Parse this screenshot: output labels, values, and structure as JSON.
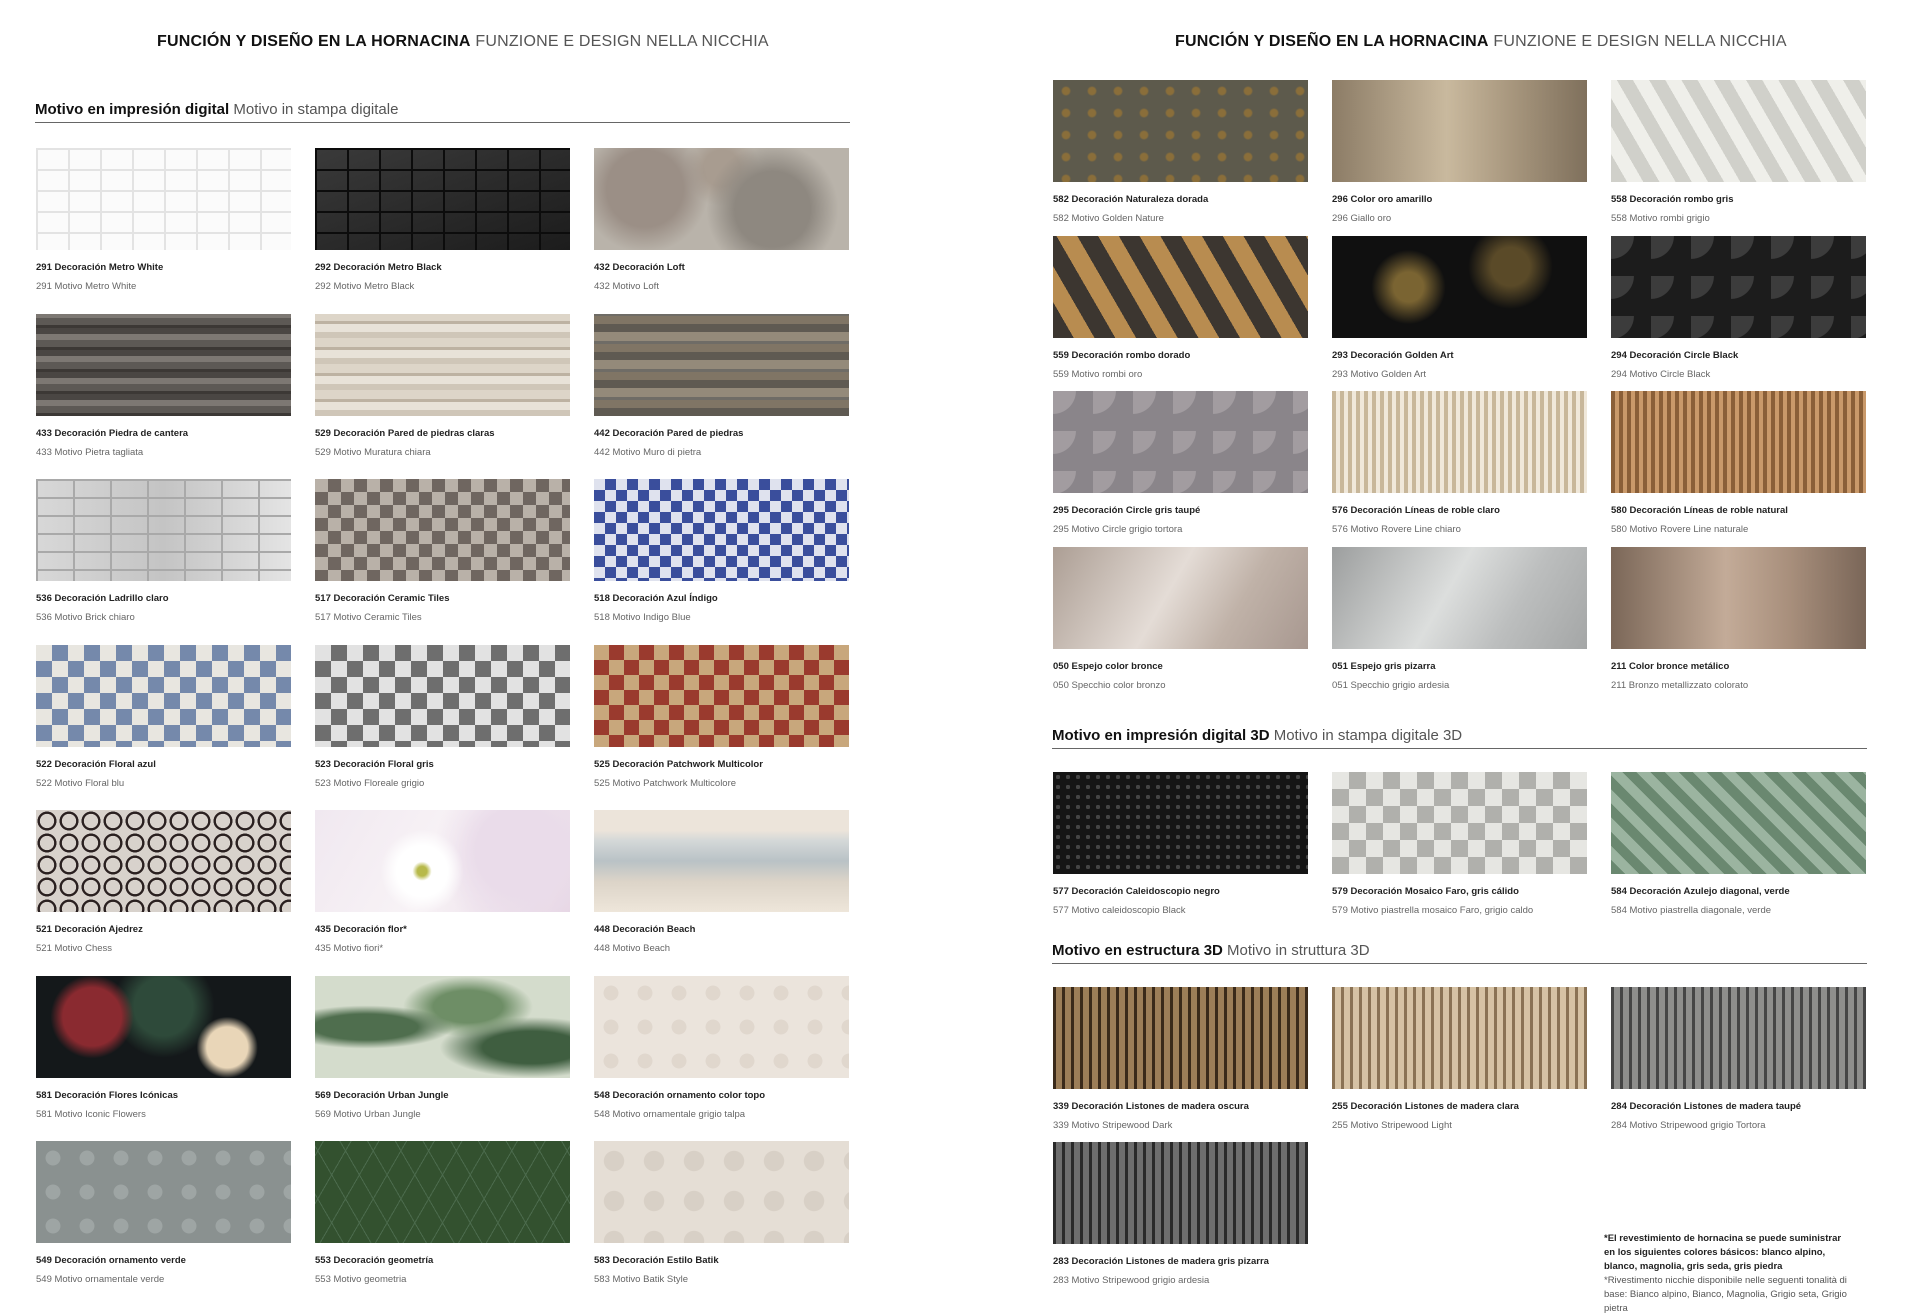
{
  "left_page": {
    "title_es": "FUNCIÓN Y DISEÑO EN LA HORNACINA",
    "title_it": "FUNZIONE E DESIGN NELLA NICCHIA",
    "section": {
      "es": "Motivo en impresión digital",
      "it": "Motivo in stampa digitale"
    },
    "tiles": [
      {
        "name_es": "291 Decoración Metro White",
        "name_it": "291 Motivo Metro White",
        "swatch": "metro-white"
      },
      {
        "name_es": "292 Decoración Metro Black",
        "name_it": "292 Motivo Metro Black",
        "swatch": "metro-black"
      },
      {
        "name_es": "432 Decoración Loft",
        "name_it": "432 Motivo Loft",
        "swatch": "loft"
      },
      {
        "name_es": "433 Decoración Piedra de cantera",
        "name_it": "433 Motivo Pietra tagliata",
        "swatch": "stone-dark"
      },
      {
        "name_es": "529 Decoración Pared de piedras claras",
        "name_it": "529 Motivo Muratura chiara",
        "swatch": "stone-light"
      },
      {
        "name_es": "442 Decoración Pared de piedras",
        "name_it": "442 Motivo Muro di pietra",
        "swatch": "stone-wall"
      },
      {
        "name_es": "536 Decoración Ladrillo claro",
        "name_it": "536 Motivo Brick chiaro",
        "swatch": "brick-light"
      },
      {
        "name_es": "517 Decoración Ceramic Tiles",
        "name_it": "517 Motivo Ceramic Tiles",
        "swatch": "ceramic"
      },
      {
        "name_es": "518 Decoración Azul Índigo",
        "name_it": "518 Motivo Indigo Blue",
        "swatch": "indigo"
      },
      {
        "name_es": "522 Decoración Floral azul",
        "name_it": "522 Motivo Floral blu",
        "swatch": "floral-blue"
      },
      {
        "name_es": "523 Decoración Floral gris",
        "name_it": "523 Motivo Floreale grigio",
        "swatch": "floral-grey"
      },
      {
        "name_es": "525 Decoración Patchwork Multicolor",
        "name_it": "525 Motivo Patchwork Multicolore",
        "swatch": "patchwork"
      },
      {
        "name_es": "521 Decoración Ajedrez",
        "name_it": "521 Motivo Chess",
        "swatch": "chess"
      },
      {
        "name_es": "435 Decoración flor*",
        "name_it": "435 Motivo fiori*",
        "swatch": "flower"
      },
      {
        "name_es": "448 Decoración Beach",
        "name_it": "448 Motivo Beach",
        "swatch": "beach"
      },
      {
        "name_es": "581 Decoración Flores Icónicas",
        "name_it": "581 Motivo Iconic Flowers",
        "swatch": "iconic-flowers"
      },
      {
        "name_es": "569 Decoración Urban Jungle",
        "name_it": "569 Motivo Urban Jungle",
        "swatch": "jungle"
      },
      {
        "name_es": "548 Decoración ornamento color topo",
        "name_it": "548 Motivo ornamentale grigio talpa",
        "swatch": "ornament-taupe"
      },
      {
        "name_es": "549 Decoración ornamento verde",
        "name_it": "549 Motivo ornamentale verde",
        "swatch": "ornament-green"
      },
      {
        "name_es": "553 Decoración geometría",
        "name_it": "553 Motivo geometria",
        "swatch": "geometry"
      },
      {
        "name_es": "583 Decoración Estilo Batik",
        "name_it": "583 Motivo Batik Style",
        "swatch": "batik"
      }
    ]
  },
  "right_page": {
    "title_es": "FUNCIÓN Y DISEÑO EN LA HORNACINA",
    "title_it": "FUNZIONE E DESIGN NELLA NICCHIA",
    "tiles_top": [
      {
        "name_es": "582 Decoración Naturaleza dorada",
        "name_it": "582 Motivo Golden Nature",
        "swatch": "golden-nature"
      },
      {
        "name_es": "296 Color oro amarillo",
        "name_it": "296 Giallo oro",
        "swatch": "gold"
      },
      {
        "name_es": "558 Decoración rombo gris",
        "name_it": "558 Motivo rombi grigio",
        "swatch": "rhombus-grey"
      },
      {
        "name_es": "559 Decoración rombo dorado",
        "name_it": "559 Motivo rombi oro",
        "swatch": "rhombus-gold"
      },
      {
        "name_es": "293 Decoración Golden Art",
        "name_it": "293 Motivo Golden Art",
        "swatch": "golden-art"
      },
      {
        "name_es": "294 Decoración Circle Black",
        "name_it": "294 Motivo Circle Black",
        "swatch": "circle-black"
      },
      {
        "name_es": "295 Decoración Circle gris taupé",
        "name_it": "295 Motivo Circle grigio tortora",
        "swatch": "circle-taupe"
      },
      {
        "name_es": "576 Decoración Líneas de roble claro",
        "name_it": "576 Motivo Rovere Line chiaro",
        "swatch": "oak-light"
      },
      {
        "name_es": "580 Decoración Líneas de roble natural",
        "name_it": "580 Motivo Rovere Line naturale",
        "swatch": "oak-natural"
      },
      {
        "name_es": "050 Espejo color bronce",
        "name_it": "050 Specchio color bronzo",
        "swatch": "mirror-bronze"
      },
      {
        "name_es": "051 Espejo gris pizarra",
        "name_it": "051 Specchio grigio ardesia",
        "swatch": "mirror-slate"
      },
      {
        "name_es": "211 Color bronce metálico",
        "name_it": "211 Bronzo metallizzato colorato",
        "swatch": "bronze-metal"
      }
    ],
    "section_3d_print": {
      "es": "Motivo en impresión digital 3D",
      "it": "Motivo in stampa digitale 3D"
    },
    "tiles_3d_print": [
      {
        "name_es": "577 Decoración Caleidoscopio negro",
        "name_it": "577 Motivo caleidoscopio Black",
        "swatch": "kaleido"
      },
      {
        "name_es": "579 Decoración Mosaico Faro, gris cálido",
        "name_it": "579 Motivo piastrella mosaico Faro, grigio caldo",
        "swatch": "mosaic-faro"
      },
      {
        "name_es": "584 Decoración Azulejo diagonal, verde",
        "name_it": "584 Motivo piastrella diagonale, verde",
        "swatch": "herringbone-green"
      }
    ],
    "section_3d_structure": {
      "es": "Motivo en estructura 3D",
      "it": "Motivo in struttura 3D"
    },
    "tiles_3d_structure": [
      {
        "name_es": "339 Decoración Listones de madera oscura",
        "name_it": "339 Motivo Stripewood Dark",
        "swatch": "stripe-dark"
      },
      {
        "name_es": "255 Decoración Listones de madera clara",
        "name_it": "255 Motivo Stripewood Light",
        "swatch": "stripe-light"
      },
      {
        "name_es": "284 Decoración Listones de madera taupé",
        "name_it": "284 Motivo Stripewood grigio Tortora",
        "swatch": "stripe-taupe"
      },
      {
        "name_es": "283 Decoración Listones de madera gris pizarra",
        "name_it": "283 Motivo Stripewood grigio ardesia",
        "swatch": "stripe-slate"
      }
    ],
    "note": {
      "es": "*El revestimiento de hornacina se puede suministrar en los siguientes colores básicos: blanco alpino, blanco, magnolia, gris seda, gris piedra",
      "it": "*Rivestimento nicchie disponibile nelle seguenti tonalità di base: Bianco alpino, Bianco, Magnolia, Grigio seta, Grigio pietra"
    }
  }
}
